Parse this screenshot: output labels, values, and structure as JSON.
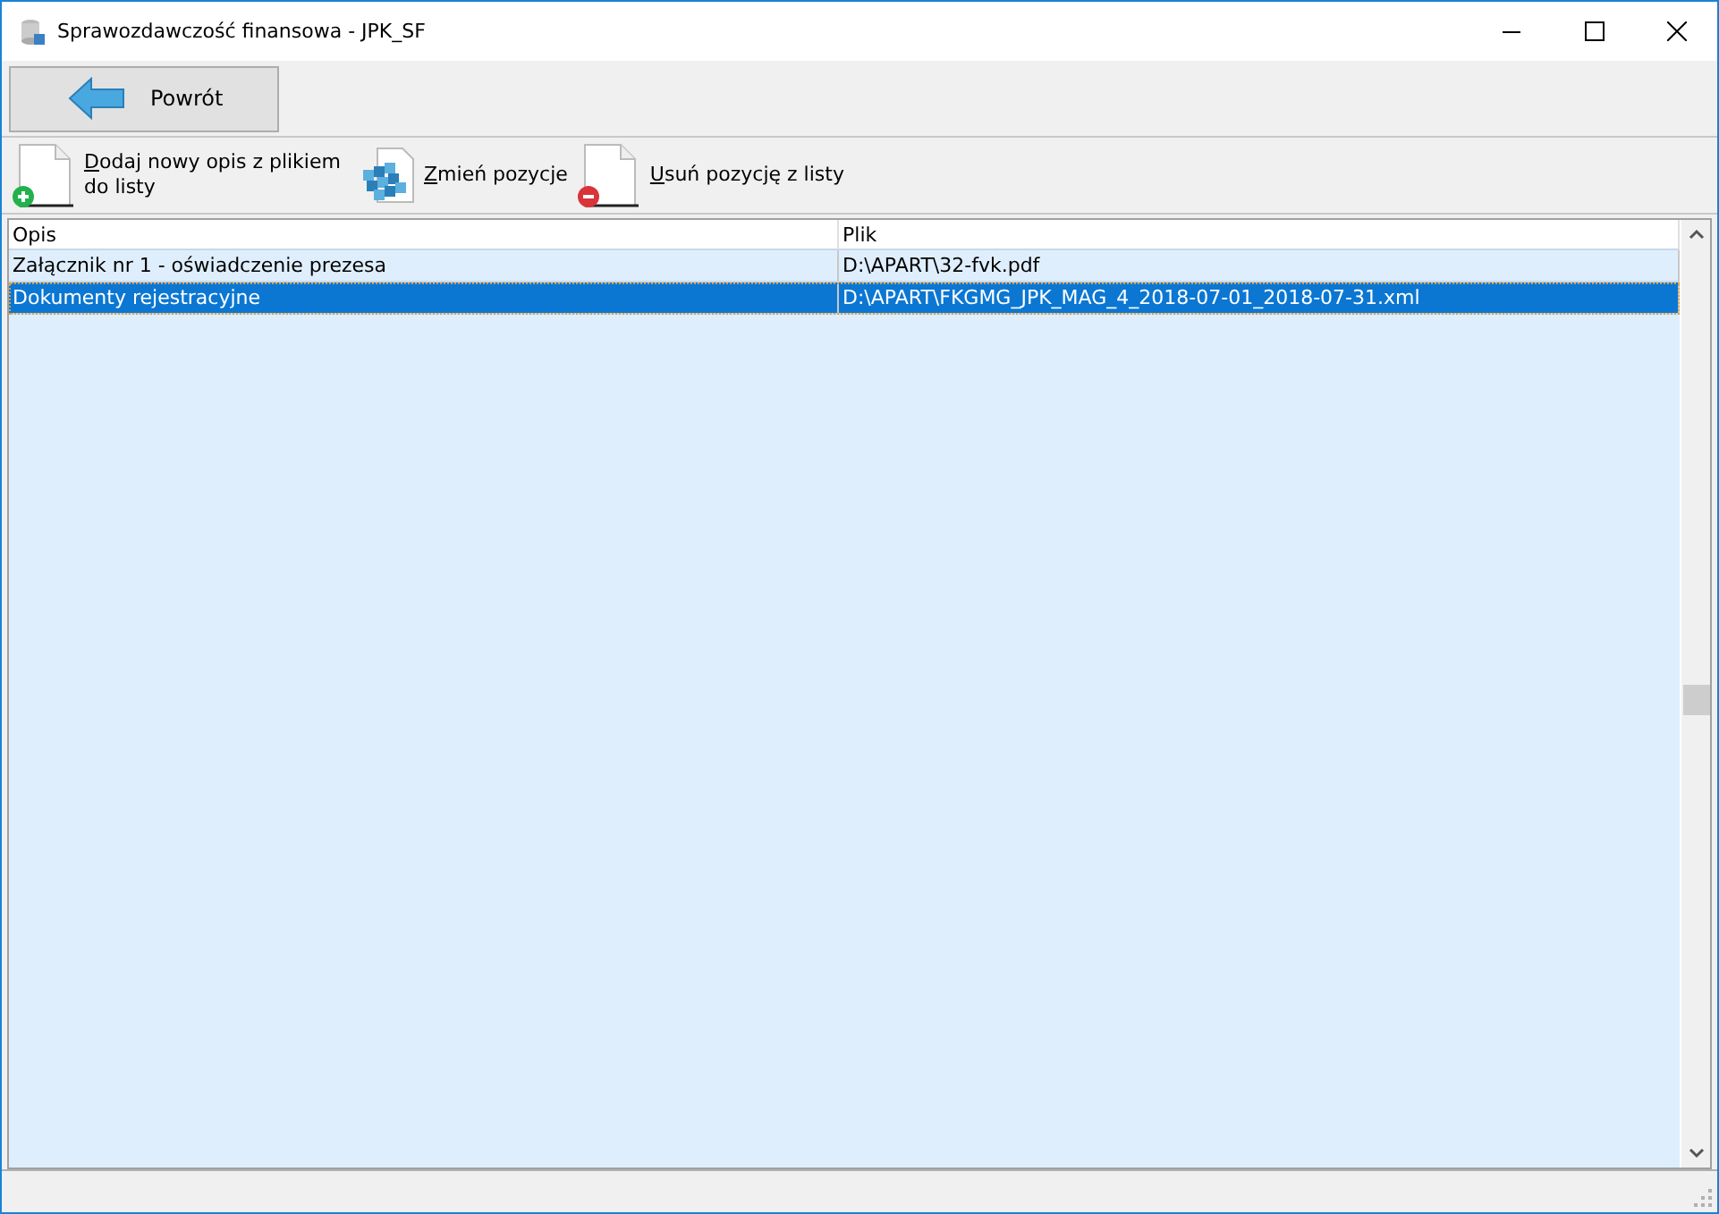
{
  "window": {
    "title": "Sprawozdawczość finansowa - JPK_SF"
  },
  "back_button": {
    "label": "Powrót"
  },
  "toolbar": [
    {
      "kind": "add",
      "label": "Dodaj nowy opis z plikiem do listy"
    },
    {
      "kind": "edit",
      "label": "Zmień pozycje"
    },
    {
      "kind": "remove",
      "label": "Usuń pozycję z listy"
    }
  ],
  "table": {
    "columns": [
      "Opis",
      "Plik"
    ],
    "rows": [
      {
        "cells": [
          "Załącznik nr 1 - oświadczenie prezesa",
          "D:\\APART\\32-fvk.pdf"
        ],
        "selected": false
      },
      {
        "cells": [
          "Dokumenty rejestracyjne",
          "D:\\APART\\FKGMG_JPK_MAG_4_2018-07-01_2018-07-31.xml"
        ],
        "selected": true
      }
    ]
  }
}
